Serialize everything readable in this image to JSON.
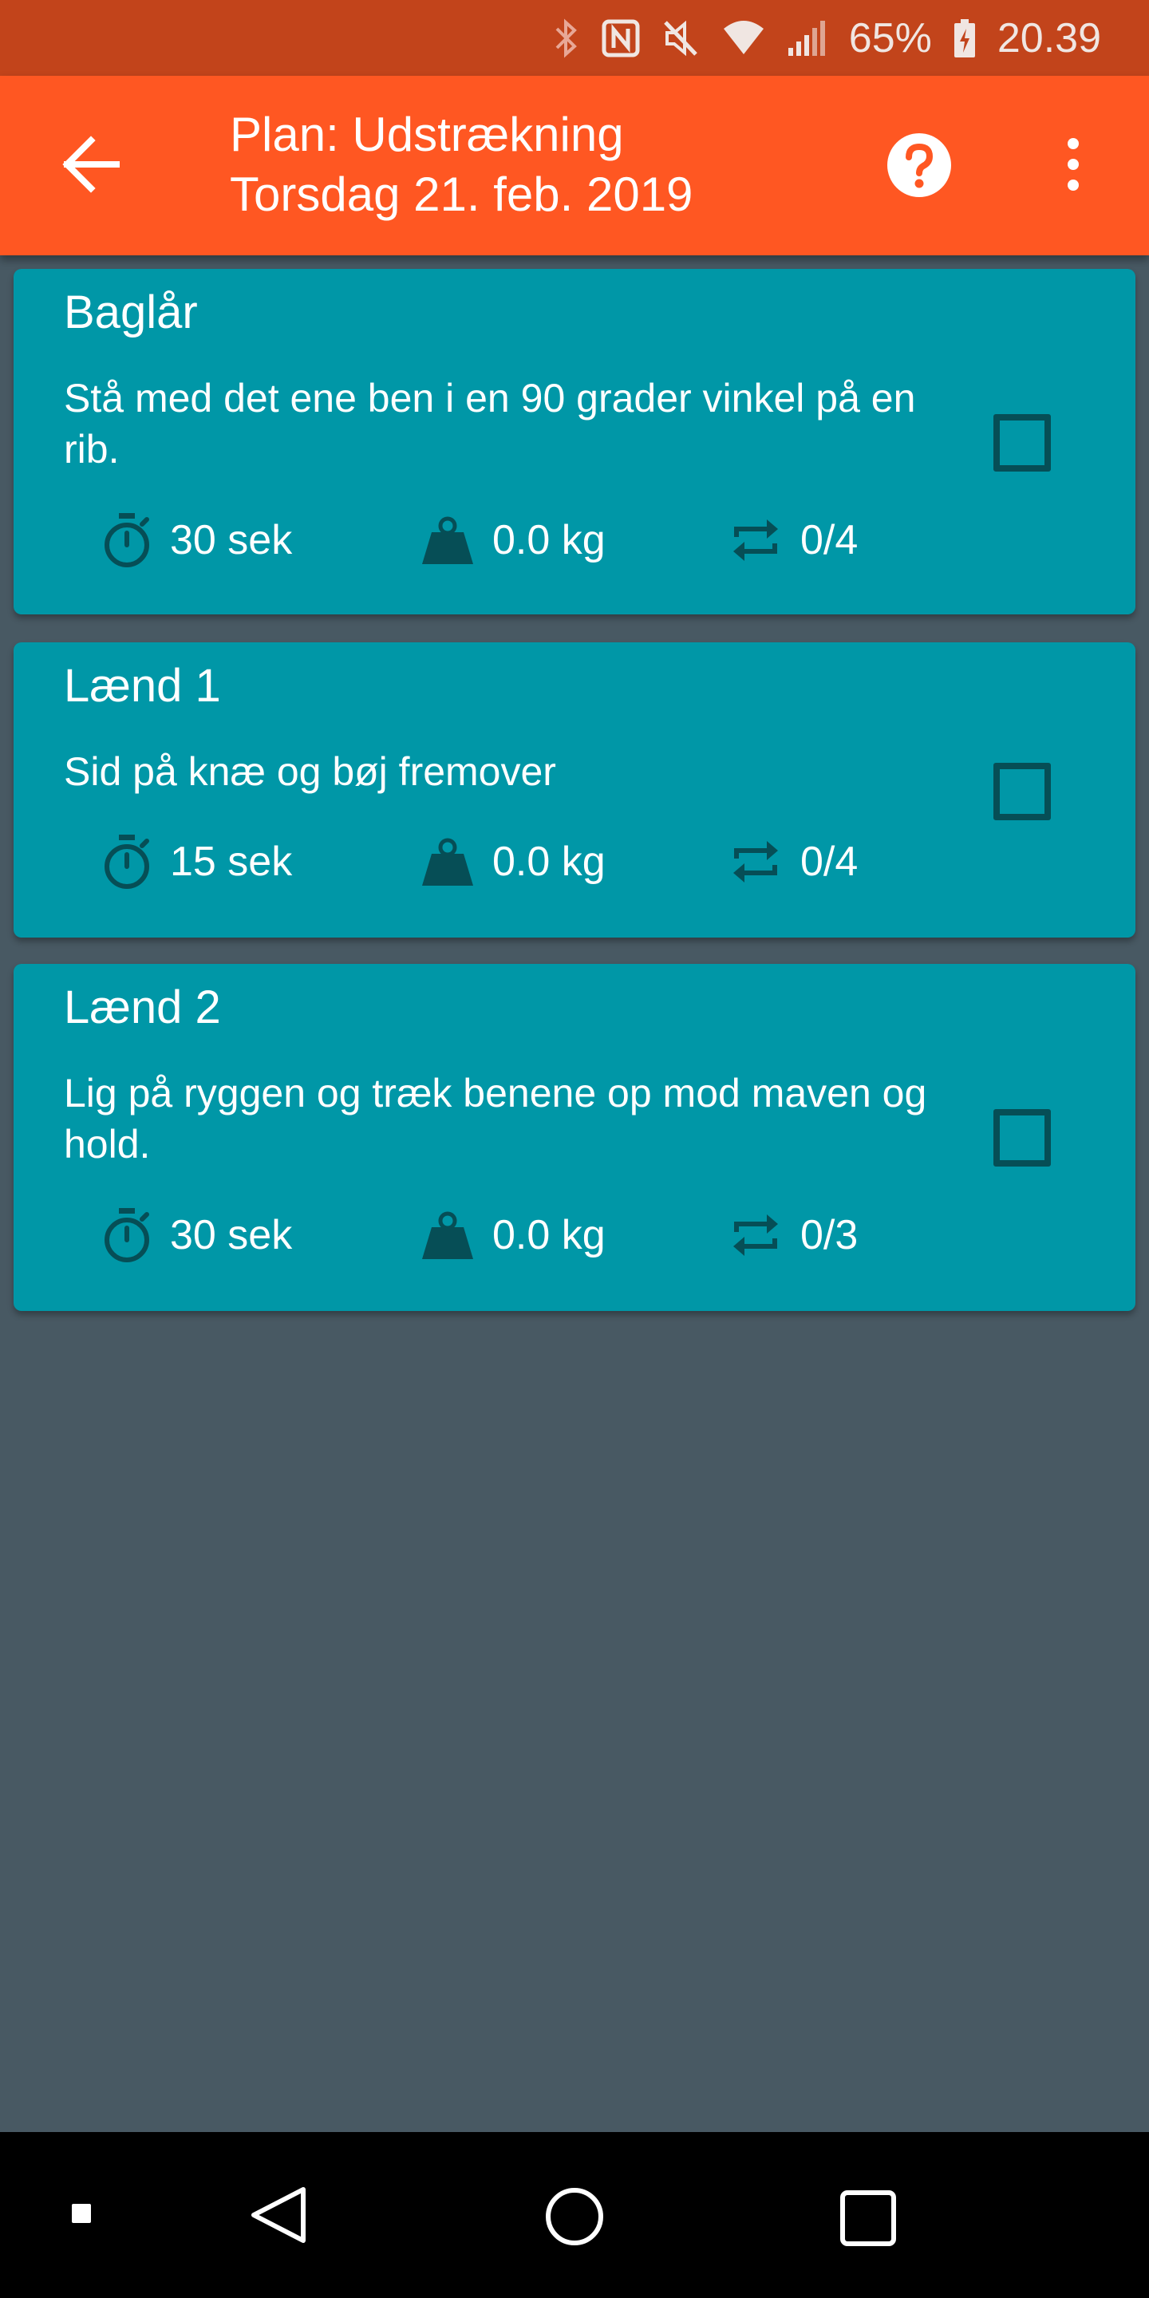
{
  "status_bar": {
    "battery": "65%",
    "time": "20.39"
  },
  "app_bar": {
    "title": "Plan: Udstrækning",
    "subtitle": "Torsdag 21. feb. 2019",
    "back_icon": "arrow-left-icon",
    "help_icon": "help-circle-icon",
    "more_icon": "more-vertical-icon"
  },
  "exercises": [
    {
      "name": "Baglår",
      "description": "Stå med det ene ben i en 90 grader vinkel på en rib.",
      "duration": "30 sek",
      "weight": "0.0 kg",
      "repetitions": "0/4",
      "checked": false
    },
    {
      "name": "Lænd 1",
      "description": "Sid på knæ og bøj fremover",
      "duration": "15 sek",
      "weight": "0.0 kg",
      "repetitions": "0/4",
      "checked": false
    },
    {
      "name": "Lænd 2",
      "description": "Lig på ryggen og træk benene op mod maven og hold.",
      "duration": "30 sek",
      "weight": "0.0 kg",
      "repetitions": "0/3",
      "checked": false
    }
  ],
  "colors": {
    "status_bar": "#C2441B",
    "app_bar": "#FF5722",
    "card": "#0097A7",
    "stat_icon": "#064E56",
    "background": "#485963"
  }
}
